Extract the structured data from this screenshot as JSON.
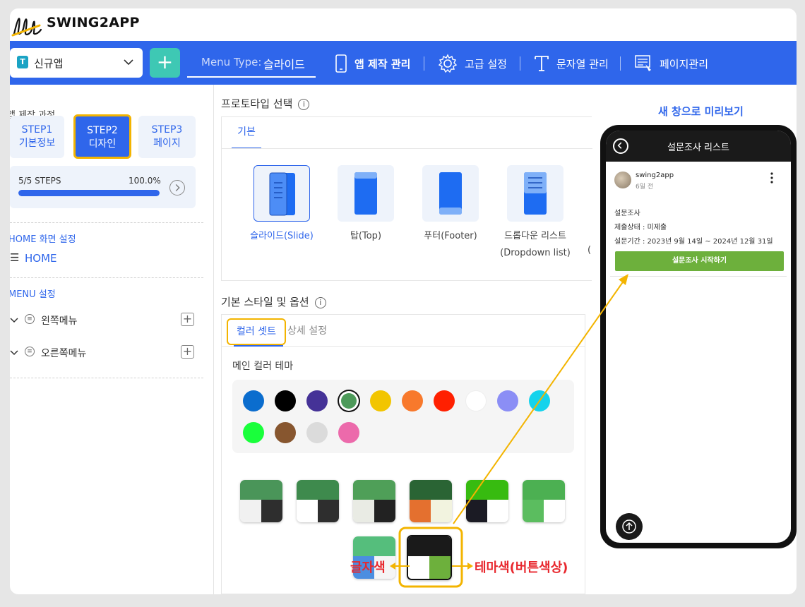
{
  "brand": "SWING2APP",
  "nav": {
    "app_name": "신규앱",
    "add_label": "+",
    "menu_type_label": "Menu Type:",
    "menu_type_value": "슬라이드",
    "items": [
      {
        "label": "앱 제작 관리",
        "icon": "phone-icon",
        "bold": true
      },
      {
        "label": "고급 설정",
        "icon": "gear-icon"
      },
      {
        "label": "문자열 관리",
        "icon": "text-icon"
      },
      {
        "label": "페이지관리",
        "icon": "page-manage-icon"
      }
    ]
  },
  "sidebar": {
    "process_title": "앱 제작 과정",
    "steps": [
      {
        "line1": "STEP1",
        "line2": "기본정보"
      },
      {
        "line1": "STEP2",
        "line2": "디자인"
      },
      {
        "line1": "STEP3",
        "line2": "페이지"
      }
    ],
    "progress_label": "5/5 STEPS",
    "progress_pct": "100.0%",
    "progress_fraction": 1.0,
    "home_title": "HOME 화면 설정",
    "home_item": "HOME",
    "menu_title": "MENU 설정",
    "menus": [
      {
        "label": "왼쪽메뉴"
      },
      {
        "label": "오른쪽메뉴"
      }
    ]
  },
  "prototype": {
    "title": "프로토타입 선택",
    "tab": "기본",
    "cards": [
      {
        "label": "슬라이드(Slide)",
        "selected": true
      },
      {
        "label": "탑(Top)"
      },
      {
        "label": "푸터(Footer)"
      },
      {
        "label": "드롭다운 리스트\n(Dropdown list)"
      }
    ],
    "cut_label": "("
  },
  "style": {
    "title": "기본 스타일 및 옵션",
    "tab_color": "컬러 셋트",
    "tab_detail": "상세 설정",
    "main_theme_label": "메인 컬러 테마",
    "swatches": [
      "#0b6dce",
      "#000000",
      "#453297",
      "#4d9a5a",
      "#f2c500",
      "#f8792c",
      "#ff2000",
      "#ffffff",
      "#8b8ef5",
      "#15d3ec",
      "#19ff3b",
      "#87562f",
      "#dbdbdb",
      "#ec6aab"
    ],
    "selected_swatch": 3,
    "combos": [
      {
        "top": "#4a9559",
        "bl": "#f1f1f1",
        "br": "#2e2e2e"
      },
      {
        "top": "#3e8a4d",
        "bl": "#ffffff",
        "br": "#2e2e2e"
      },
      {
        "top": "#4f9f58",
        "bl": "#e9ebe4",
        "br": "#222222"
      },
      {
        "top": "#2a6434",
        "bl": "#e4702f",
        "br": "#f2f3df"
      },
      {
        "top": "#37bb10",
        "bl": "#1b1b24",
        "br": "#ffffff"
      },
      {
        "top": "#4cb052",
        "bl": "#5bbd5f",
        "br": "#ffffff"
      },
      {
        "top": "#55be7c",
        "bl": "#4b8ee0",
        "br": "#f5f5f5"
      },
      {
        "top": "#1a1a1a",
        "bl": "#ffffff",
        "br": "#6db03c"
      }
    ]
  },
  "preview": {
    "link": "새 창으로 미리보기",
    "screen_title": "설문조사 리스트",
    "user": "swing2app",
    "time": "6일 전",
    "lines": [
      "설문조사",
      "제출상태 : 미제출",
      "설문기간 : 2023년 9월 14일 ~ 2024년 12월 31일"
    ],
    "button": "설문조사 시작하기"
  },
  "callouts": {
    "left": "글자색",
    "right": "테마색(버튼색상)"
  },
  "colors": {
    "primary": "#2f66eb",
    "highlight": "#f3b400",
    "callout": "#e8272d",
    "button_green": "#6db03c"
  }
}
